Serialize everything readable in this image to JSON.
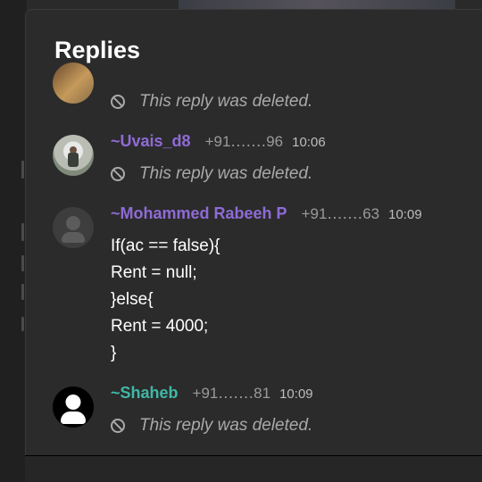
{
  "panel": {
    "title": "Replies"
  },
  "replies": [
    {
      "name": "",
      "deleted_text": "This reply was deleted."
    },
    {
      "name": "~Uvais_d8",
      "name_color": "#8f6bd6",
      "phone": "+91․․․․․․․96",
      "time": "10:06",
      "deleted_text": "This reply was deleted."
    },
    {
      "name": "~Mohammed Rabeeh P",
      "name_color": "#8f6bd6",
      "phone": "+91․․․․․․․63",
      "time": "10:09",
      "message_lines": [
        "If(ac == false){",
        "Rent = null;",
        "}else{",
        "Rent = 4000;",
        "}"
      ]
    },
    {
      "name": "~Shaheb",
      "name_color": "#3fb8a6",
      "phone": "+91․․․․․․․81",
      "time": "10:09",
      "deleted_text": "This reply was deleted."
    }
  ],
  "icons": {
    "deleted": "ban-icon",
    "default_avatar": "person-icon"
  }
}
